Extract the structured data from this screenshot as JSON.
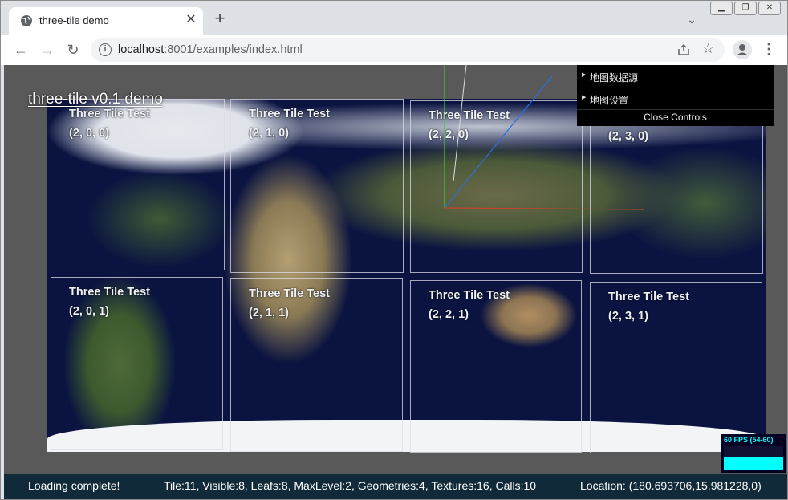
{
  "browser": {
    "tab_title": "three-tile demo",
    "tab_icon": "globe-icon",
    "new_tab": "+",
    "url_host": "localhost",
    "url_path": ":8001/examples/index.html"
  },
  "page": {
    "title": "three-tile v0.1 demo",
    "tile_label": "Three Tile Test",
    "tiles": [
      {
        "label": "Three Tile Test",
        "coord": "(2, 0, 0)"
      },
      {
        "label": "Three Tile Test",
        "coord": "(2, 1, 0)"
      },
      {
        "label": "Three Tile Test",
        "coord": "(2, 2, 0)"
      },
      {
        "label": "Three Tile Test",
        "coord": "(2, 3, 0)"
      },
      {
        "label": "Three Tile Test",
        "coord": "(2, 0, 1)"
      },
      {
        "label": "Three Tile Test",
        "coord": "(2, 1, 1)"
      },
      {
        "label": "Three Tile Test",
        "coord": "(2, 2, 1)"
      },
      {
        "label": "Three Tile Test",
        "coord": "(2, 3, 1)"
      }
    ]
  },
  "controls": {
    "folders": [
      "地图数据源",
      "地图设置"
    ],
    "close_label": "Close Controls"
  },
  "fps": {
    "text": "60 FPS (54-60)",
    "level": 0.55,
    "color": "#00ffff"
  },
  "status": {
    "loading": "Loading complete!",
    "stats": "Tile:11, Visible:8, Leafs:8, MaxLevel:2, Geometries:4, Textures:16, Calls:10",
    "location": "Location: (180.693706,15.981228,0)"
  },
  "colors": {
    "axis_x": "#c8442a",
    "axis_y": "#3bd12e",
    "axis_z": "#2a6fe0",
    "status_bg": "#112a3a"
  }
}
